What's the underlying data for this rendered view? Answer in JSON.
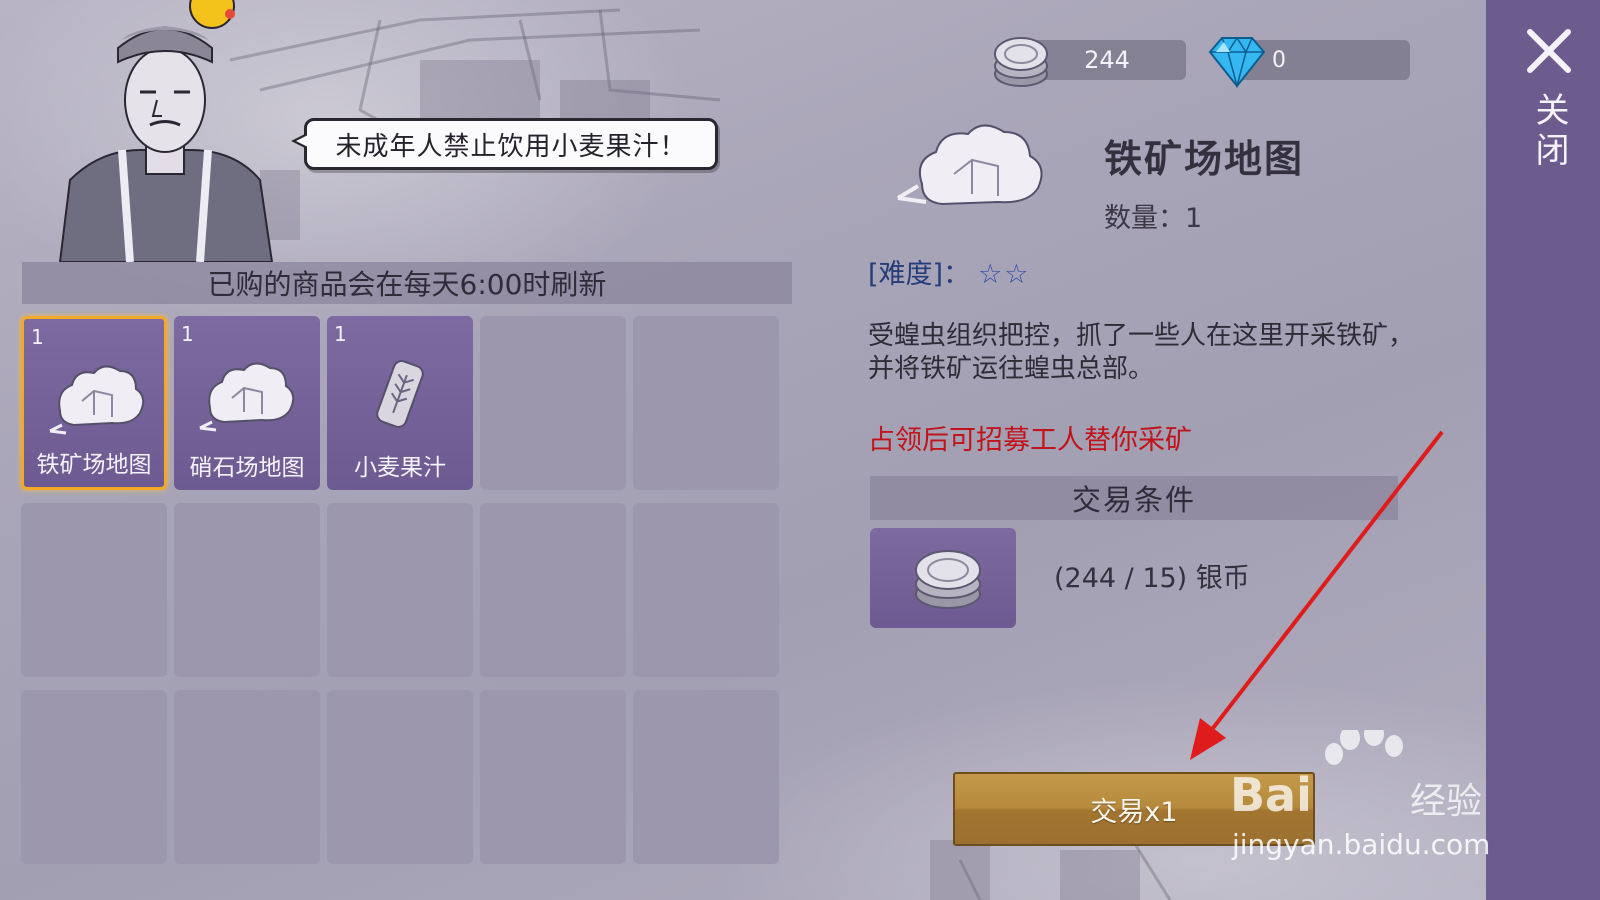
{
  "npc": {
    "speech": "未成年人禁止饮用小麦果汁！"
  },
  "shop": {
    "refresh_note": "已购的商品会在每天6:00时刷新",
    "items": [
      {
        "qty": "1",
        "name": "铁矿场地图",
        "icon": "rock-map-icon",
        "selected": true
      },
      {
        "qty": "1",
        "name": "硝石场地图",
        "icon": "rock-map-icon",
        "selected": false
      },
      {
        "qty": "1",
        "name": "小麦果汁",
        "icon": "wheat-can-icon",
        "selected": false
      }
    ]
  },
  "currency": {
    "silver": "244",
    "gems": "0"
  },
  "detail": {
    "title": "铁矿场地图",
    "qty_label": "数量：1",
    "difficulty_label": "[难度]：",
    "difficulty_stars": "☆☆",
    "description": "受蝗虫组织把控，抓了一些人在这里开采铁矿，并将铁矿运往蝗虫总部。",
    "note": "占领后可招募工人替你采矿",
    "note_color": "#c1141a",
    "conditions_header": "交易条件",
    "condition_text": "(244 / 15) 银币"
  },
  "actions": {
    "trade": "交易x1",
    "close": "关闭"
  },
  "watermark": {
    "brand": "Bai",
    "brand_suffix": "经验",
    "url": "jingyan.baidu.com"
  },
  "colors": {
    "accent_gold": "#b6893c",
    "panel_purple": "#6c5b8d",
    "selected_border": "#f2a928"
  }
}
